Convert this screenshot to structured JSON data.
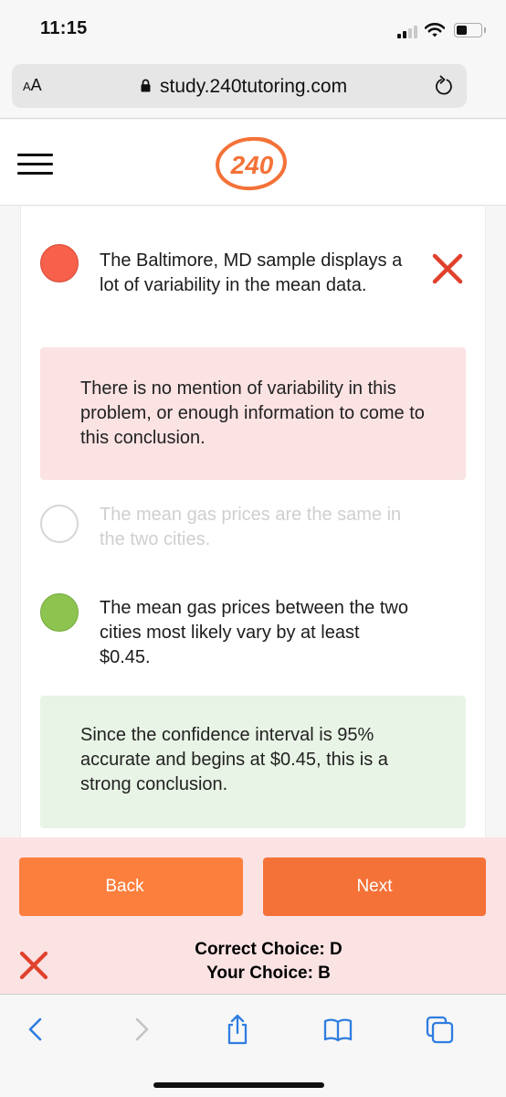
{
  "status_bar": {
    "time": "11:15",
    "signal_bars_filled": 2,
    "signal_bars_total": 4,
    "battery_level": 0.45,
    "icons": [
      "signal-icon",
      "wifi-icon",
      "battery-icon"
    ]
  },
  "browser": {
    "text_size_button": {
      "small": "A",
      "large": "A"
    },
    "url": "study.240tutoring.com",
    "icons": {
      "lock": "lock-icon",
      "reload": "reload-icon"
    }
  },
  "site_header": {
    "logo_text": "240",
    "menu_icon": "hamburger-menu-icon",
    "brand_color": "#f47238"
  },
  "question": {
    "options": [
      {
        "state": "selected-wrong",
        "text": "The Baltimore, MD sample displays a lot of variability in the mean data.",
        "marker": "x-icon",
        "feedback": "There is no mention of variability in this problem, or enough information to come to this conclusion."
      },
      {
        "state": "unselected",
        "text": "The mean gas prices are the same in the two cities."
      },
      {
        "state": "correct",
        "text": "The mean gas prices between the two cities most likely vary by at least $0.45.",
        "feedback": "Since the confidence interval is 95% accurate and begins at $0.45, this is a strong conclusion."
      }
    ]
  },
  "result": {
    "back_label": "Back",
    "next_label": "Next",
    "correct_choice": "Correct Choice: D",
    "your_choice": "Your Choice: B",
    "status_icon": "x-icon"
  },
  "colors": {
    "wrong": "#f7604a",
    "correct": "#8dc44f",
    "wrong_bg": "#fbe2e3",
    "correct_bg": "#e8f4e5",
    "button": "#fc7f3d",
    "ios_blue": "#2f7de1"
  },
  "toolbar": {
    "items": [
      "back-icon",
      "forward-icon",
      "share-icon",
      "bookmarks-icon",
      "tabs-icon"
    ]
  }
}
